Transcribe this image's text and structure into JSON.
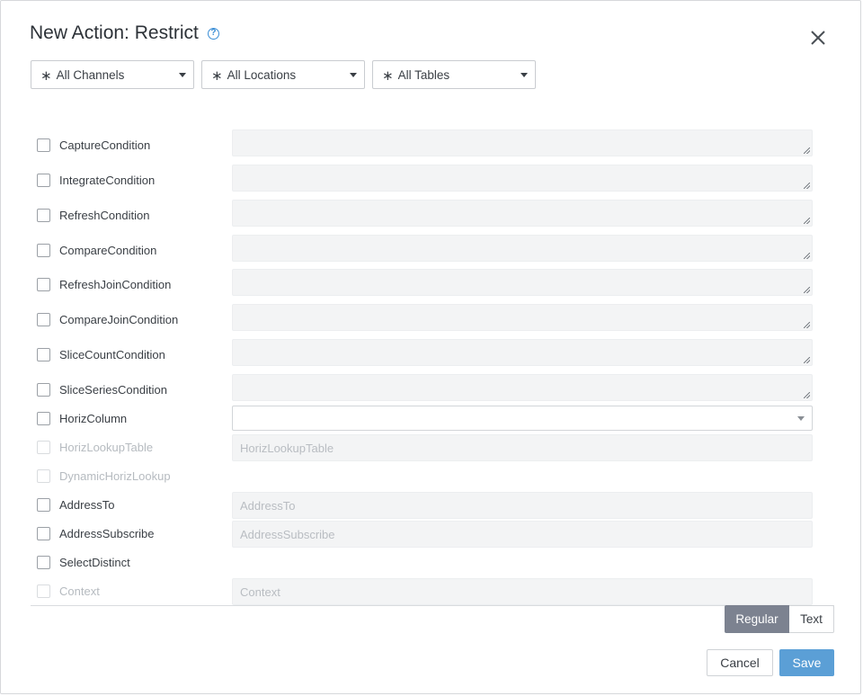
{
  "dialog": {
    "title": "New Action: Restrict",
    "help_icon": "question-circle-icon",
    "close_icon": "close-icon"
  },
  "filters": [
    {
      "label": "All Channels",
      "icon": "asterisk-icon"
    },
    {
      "label": "All Locations",
      "icon": "asterisk-icon"
    },
    {
      "label": "All Tables",
      "icon": "asterisk-icon"
    }
  ],
  "parameters": [
    {
      "label": "CaptureCondition",
      "enabled": true,
      "field": "textarea"
    },
    {
      "label": "IntegrateCondition",
      "enabled": true,
      "field": "textarea"
    },
    {
      "label": "RefreshCondition",
      "enabled": true,
      "field": "textarea"
    },
    {
      "label": "CompareCondition",
      "enabled": true,
      "field": "textarea"
    },
    {
      "label": "RefreshJoinCondition",
      "enabled": true,
      "field": "textarea"
    },
    {
      "label": "CompareJoinCondition",
      "enabled": true,
      "field": "textarea"
    },
    {
      "label": "SliceCountCondition",
      "enabled": true,
      "field": "textarea"
    },
    {
      "label": "SliceSeriesCondition",
      "enabled": true,
      "field": "textarea"
    },
    {
      "label": "HorizColumn",
      "enabled": true,
      "field": "select",
      "value": ""
    },
    {
      "label": "HorizLookupTable",
      "enabled": false,
      "field": "input",
      "placeholder": "HorizLookupTable"
    },
    {
      "label": "DynamicHorizLookup",
      "enabled": false,
      "field": "none"
    },
    {
      "label": "AddressTo",
      "enabled": true,
      "field": "input",
      "placeholder": "AddressTo"
    },
    {
      "label": "AddressSubscribe",
      "enabled": true,
      "field": "input",
      "placeholder": "AddressSubscribe"
    },
    {
      "label": "SelectDistinct",
      "enabled": true,
      "field": "none"
    },
    {
      "label": "Context",
      "enabled": false,
      "field": "input",
      "placeholder": "Context"
    }
  ],
  "mode_toggle": {
    "regular": "Regular",
    "text": "Text",
    "selected": "Regular"
  },
  "footer": {
    "cancel_label": "Cancel",
    "save_label": "Save"
  },
  "colors": {
    "accent": "#5b9fd6",
    "toggle_active": "#7c8290",
    "help": "#3b8ed6"
  }
}
